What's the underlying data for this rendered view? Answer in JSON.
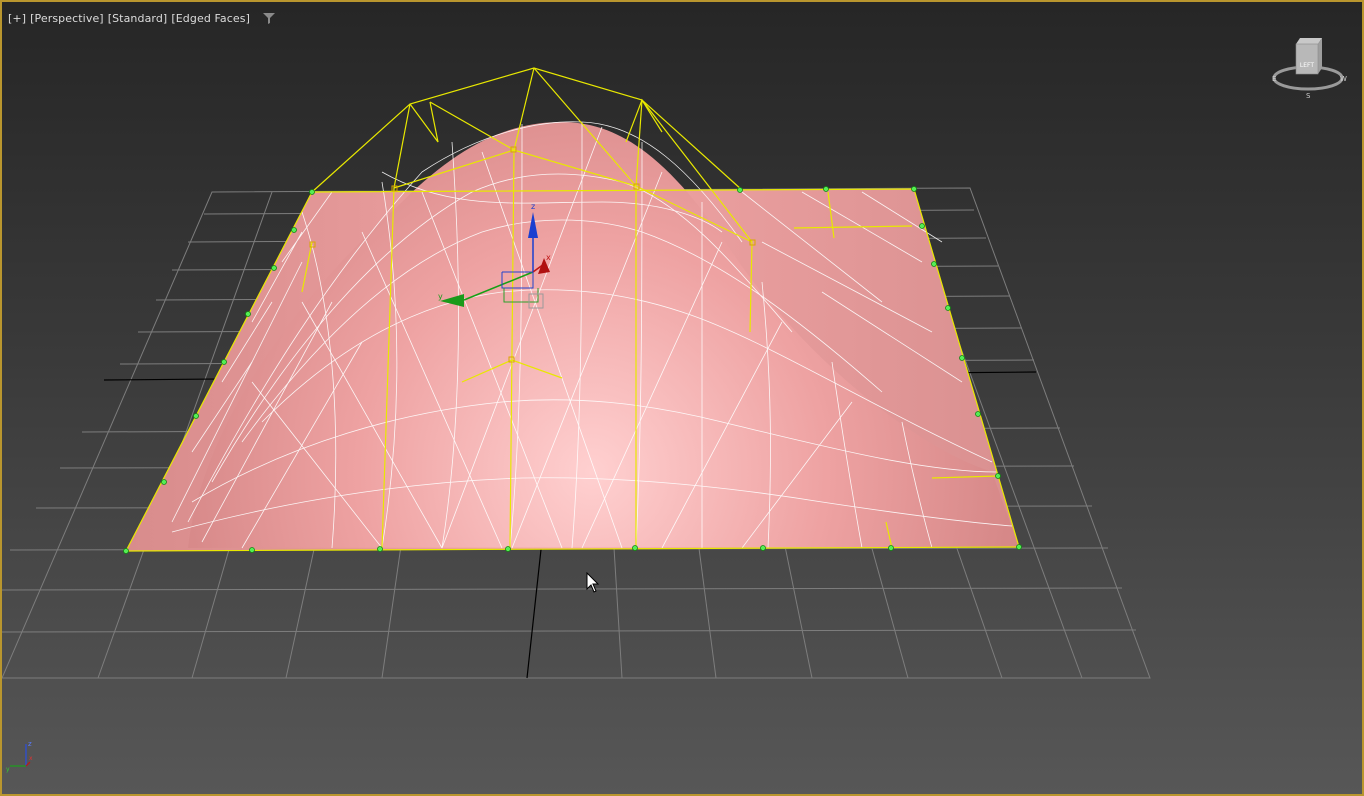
{
  "viewport": {
    "labels": {
      "plus": "[+]",
      "view": "[Perspective]",
      "shading": "[Standard]",
      "mode": "[Edged Faces]"
    },
    "filter_icon": "funnel-icon",
    "viewcube_face": "LEFT",
    "gizmo_axes": {
      "z": "z",
      "x": "x",
      "y": "y"
    },
    "tripod_axes": {
      "z": "z",
      "x": "x",
      "y": "y"
    }
  },
  "colors": {
    "border": "#b9962e",
    "mesh_fill": "#f0a6a6",
    "wire": "#ffffff",
    "cage": "#e8e800",
    "vertex": "#33cc33"
  }
}
